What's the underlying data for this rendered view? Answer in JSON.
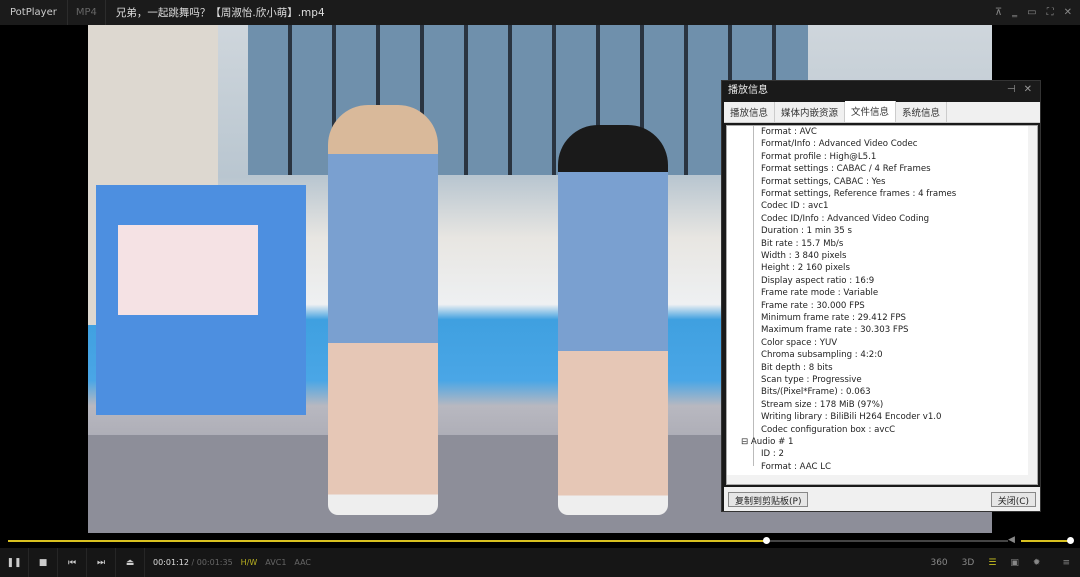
{
  "titlebar": {
    "app": "PotPlayer",
    "format": "MP4",
    "filename": "兄弟，一起跳舞吗？【周淑怡.欣小萌】.mp4"
  },
  "dialog": {
    "title": "播放信息",
    "tabs": [
      {
        "label": "播放信息"
      },
      {
        "label": "媒体内嵌资源"
      },
      {
        "label": "文件信息",
        "active": true
      },
      {
        "label": "系统信息"
      }
    ],
    "items": [
      {
        "text": "Format : AVC",
        "level": 2
      },
      {
        "text": "Format/Info : Advanced Video Codec",
        "level": 2
      },
      {
        "text": "Format profile : High@L5.1",
        "level": 2
      },
      {
        "text": "Format settings : CABAC / 4 Ref Frames",
        "level": 2
      },
      {
        "text": "Format settings, CABAC : Yes",
        "level": 2
      },
      {
        "text": "Format settings, Reference frames : 4 frames",
        "level": 2
      },
      {
        "text": "Codec ID : avc1",
        "level": 2
      },
      {
        "text": "Codec ID/Info : Advanced Video Coding",
        "level": 2
      },
      {
        "text": "Duration : 1 min 35 s",
        "level": 2
      },
      {
        "text": "Bit rate : 15.7 Mb/s",
        "level": 2
      },
      {
        "text": "Width : 3 840 pixels",
        "level": 2
      },
      {
        "text": "Height : 2 160 pixels",
        "level": 2
      },
      {
        "text": "Display aspect ratio : 16:9",
        "level": 2
      },
      {
        "text": "Frame rate mode : Variable",
        "level": 2
      },
      {
        "text": "Frame rate : 30.000 FPS",
        "level": 2
      },
      {
        "text": "Minimum frame rate : 29.412 FPS",
        "level": 2
      },
      {
        "text": "Maximum frame rate : 30.303 FPS",
        "level": 2
      },
      {
        "text": "Color space : YUV",
        "level": 2
      },
      {
        "text": "Chroma subsampling : 4:2:0",
        "level": 2
      },
      {
        "text": "Bit depth : 8 bits",
        "level": 2
      },
      {
        "text": "Scan type : Progressive",
        "level": 2
      },
      {
        "text": "Bits/(Pixel*Frame) : 0.063",
        "level": 2
      },
      {
        "text": "Stream size : 178 MiB (97%)",
        "level": 2
      },
      {
        "text": "Writing library : BiliBili H264 Encoder v1.0",
        "level": 2
      },
      {
        "text": "Codec configuration box : avcC",
        "level": 2
      },
      {
        "text": "⊟ Audio # 1",
        "level": 1
      },
      {
        "text": "ID : 2",
        "level": 2
      },
      {
        "text": "Format : AAC LC",
        "level": 2
      }
    ],
    "copy_button": "复制到剪贴板(P)",
    "close_button": "关闭(C)"
  },
  "player": {
    "current_time": "00:01:12",
    "total_time": "00:01:35",
    "separator": "/",
    "badges": [
      "H/W",
      "AVC1",
      "AAC"
    ],
    "progress": 0.758,
    "volume": 1.0,
    "accent": "#d8c020"
  }
}
